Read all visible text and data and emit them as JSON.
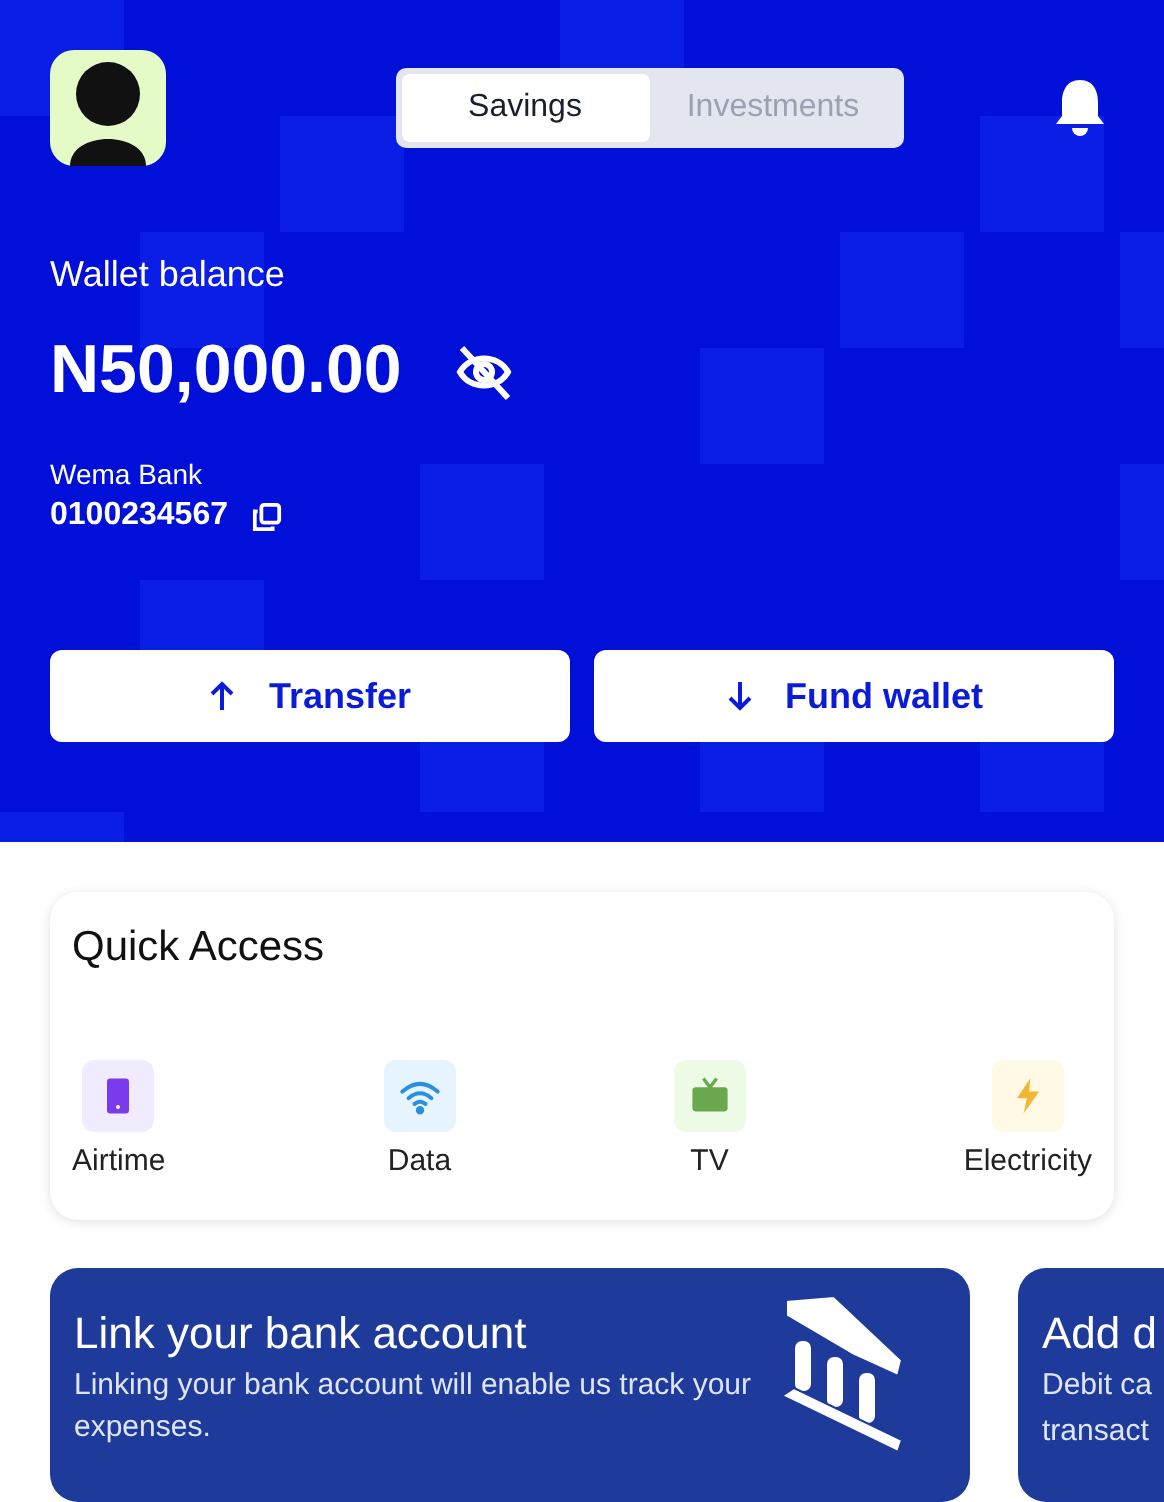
{
  "header": {
    "tabs": [
      {
        "label": "Savings",
        "selected": true
      },
      {
        "label": "Investments",
        "selected": false
      }
    ],
    "balance_label": "Wallet balance",
    "balance": "N50,000.00",
    "balance_hidden": false,
    "bank_name": "Wema Bank",
    "account_number": "0100234567"
  },
  "actions": [
    {
      "label": "Transfer",
      "kind": "up"
    },
    {
      "label": "Fund wallet",
      "kind": "down"
    }
  ],
  "quick_access": {
    "title": "Quick Access",
    "items": [
      {
        "label": "Airtime",
        "kind": "phone",
        "color": "#7c3aed"
      },
      {
        "label": "Data",
        "kind": "wifi",
        "color": "#2b8ee0"
      },
      {
        "label": "TV",
        "kind": "tv",
        "color": "#6aa84f"
      },
      {
        "label": "Electricity",
        "kind": "bolt",
        "color": "#f2b632"
      }
    ]
  },
  "promos": [
    {
      "title": "Link your bank account",
      "text": "Linking your bank account will enable us track your expenses."
    },
    {
      "title": "Add d",
      "lines": [
        "Debit ca",
        "transact"
      ]
    }
  ]
}
